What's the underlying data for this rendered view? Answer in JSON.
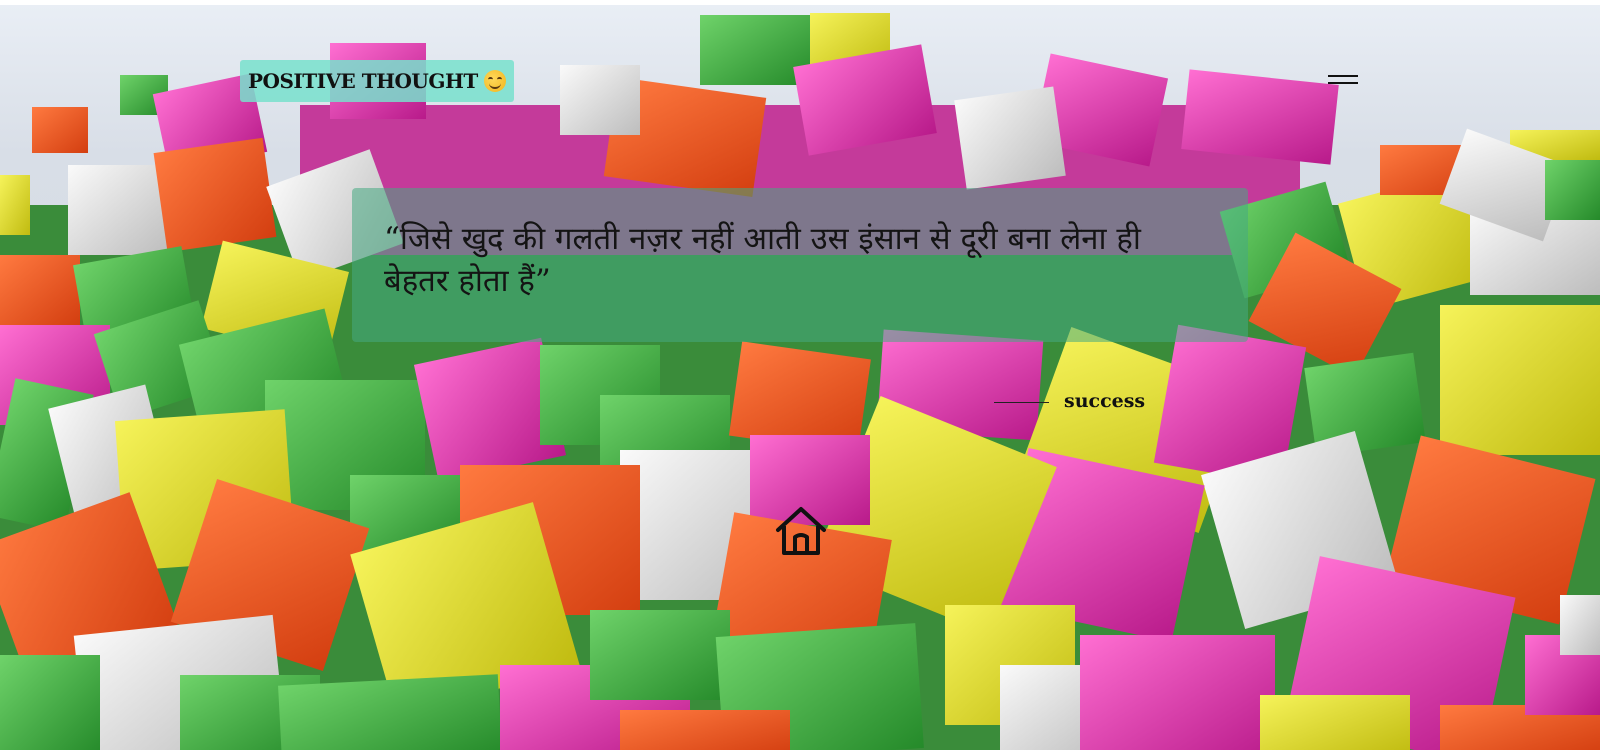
{
  "site": {
    "logo_text": "POSITIVE THOUGHT",
    "logo_emoji_icon": "smiling-face-hands-icon"
  },
  "header": {
    "menu_icon": "hamburger-menu-icon"
  },
  "quote": {
    "text": "“जिसे खुद की गलती नज़र नहीं आती उस इंसान से दूरी बना लेना ही बेहतर होता हैं”",
    "author": "success"
  },
  "nav": {
    "home_icon": "home-icon"
  },
  "colors": {
    "badge_bg": "#78e1cd",
    "quote_box_bg": "#46aa82",
    "text": "#141414",
    "cube_green": "#3fae3f",
    "cube_magenta": "#e02fb0",
    "cube_orange": "#f0541e",
    "cube_yellow": "#e6e22a",
    "cube_white": "#e8e8e8"
  }
}
